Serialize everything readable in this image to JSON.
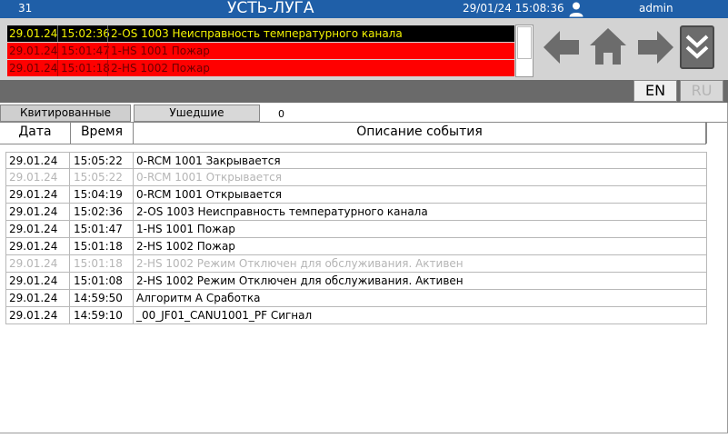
{
  "titlebar": {
    "number": "31",
    "title": "УСТЬ-ЛУГА",
    "datetime": "29/01/24 15:08:36",
    "user": "admin"
  },
  "active_alarms": [
    {
      "date": "29.01.24",
      "time": "15:02:36",
      "description": "2-OS 1003 Неисправность температурного канала",
      "style": "black"
    },
    {
      "date": "29.01.24",
      "time": "15:01:47",
      "description": "1-HS 1001 Пожар",
      "style": "red"
    },
    {
      "date": "29.01.24",
      "time": "15:01:18",
      "description": "2-HS 1002 Пожар",
      "style": "red"
    }
  ],
  "languages": {
    "en": "EN",
    "ru": "RU"
  },
  "tabs": {
    "acknowledged": "Квитированные",
    "gone": "Ушедшие",
    "count": "0"
  },
  "columns": {
    "date": "Дата",
    "time": "Время",
    "description": "Описание события"
  },
  "events": [
    {
      "date": "29.01.24",
      "time": "15:05:22",
      "description": "0-RCM 1001 Закрывается",
      "dim": false
    },
    {
      "date": "29.01.24",
      "time": "15:05:22",
      "description": "0-RCM 1001 Открывается",
      "dim": true
    },
    {
      "date": "29.01.24",
      "time": "15:04:19",
      "description": "0-RCM 1001 Открывается",
      "dim": false
    },
    {
      "date": "29.01.24",
      "time": "15:02:36",
      "description": "2-OS 1003 Неисправность температурного канала",
      "dim": false
    },
    {
      "date": "29.01.24",
      "time": "15:01:47",
      "description": "1-HS 1001 Пожар",
      "dim": false
    },
    {
      "date": "29.01.24",
      "time": "15:01:18",
      "description": "2-HS 1002 Пожар",
      "dim": false
    },
    {
      "date": "29.01.24",
      "time": "15:01:18",
      "description": "2-HS 1002 Режим Отключен для обслуживания. Активен",
      "dim": true
    },
    {
      "date": "29.01.24",
      "time": "15:01:08",
      "description": "2-HS 1002 Режим Отключен для обслуживания. Активен",
      "dim": false
    },
    {
      "date": "29.01.24",
      "time": "14:59:50",
      "description": "Алгоритм А Сработка",
      "dim": false
    },
    {
      "date": "29.01.24",
      "time": "14:59:10",
      "description": "_00_JF01_CANU1001_PF Сигнал",
      "dim": false
    }
  ],
  "colors": {
    "titlebar": "#1f5fa8",
    "alarm_red": "#ff0000",
    "alarm_black": "#000000",
    "alarm_yellow_text": "#f2f200",
    "nav_icon": "#6c6c6c"
  },
  "icons": [
    "user-icon",
    "arrow-left-icon",
    "home-icon",
    "arrow-right-icon",
    "double-chevron-down-icon"
  ]
}
